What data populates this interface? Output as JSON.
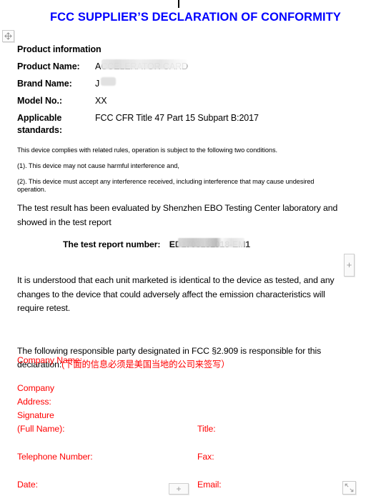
{
  "document": {
    "title": "FCC SUPPLIER’S DECLARATION OF CONFORMITY",
    "title_color": "#0000ff",
    "section_heading": "Product information",
    "product_info": [
      {
        "label": "Product Name:",
        "value": "A",
        "redacted": true
      },
      {
        "label": "Brand Name:",
        "value": "J",
        "redacted": true
      },
      {
        "label": "Model No.:",
        "value": "XX",
        "redacted": false
      },
      {
        "label": "Applicable standards:",
        "label_line1": "Applicable",
        "label_line2": "standards:",
        "value": "FCC CFR Title 47 Part 15 Subpart B:2017",
        "redacted": false
      }
    ],
    "conditions_intro": "This device complies with related rules, operation is subject to the following two conditions.",
    "condition_1": "(1). This device may not cause harmful interference and,",
    "condition_2": "(2). This device must accept any interference received, including interference that may cause undesired operation.",
    "evaluation_paragraph": "The test result has been evaluated by Shenzhen EBO Testing Center laboratory and showed in the test report",
    "report_label": "The test report number:",
    "report_number_visible": "E",
    "understood_paragraph": "It is understood that each unit marketed is identical to the device as tested, and any changes to the device that could adversely affect the emission characteristics will require retest.",
    "responsible_paragraph_en": "The following responsible party  designated in FCC §2.909 is responsible for this declaration:",
    "responsible_note_cn": "(下面的信息必须是美国当地的公司来签写）",
    "note_color": "#ff0000"
  },
  "signature_form": {
    "color": "#ff0000",
    "fields": {
      "company_name": "Company Name:",
      "company": "Company",
      "address": "Address:",
      "signature": "Signature",
      "full_name": "(Full Name):",
      "title": "Title:",
      "telephone": "Telephone Number:",
      "fax": "Fax:",
      "date": "Date:",
      "email": "Email:"
    }
  },
  "controls": {
    "move_handle": "move-handle",
    "right_add_label": "+",
    "bottom_add_label": "+",
    "resize_handle": "resize-handle"
  }
}
